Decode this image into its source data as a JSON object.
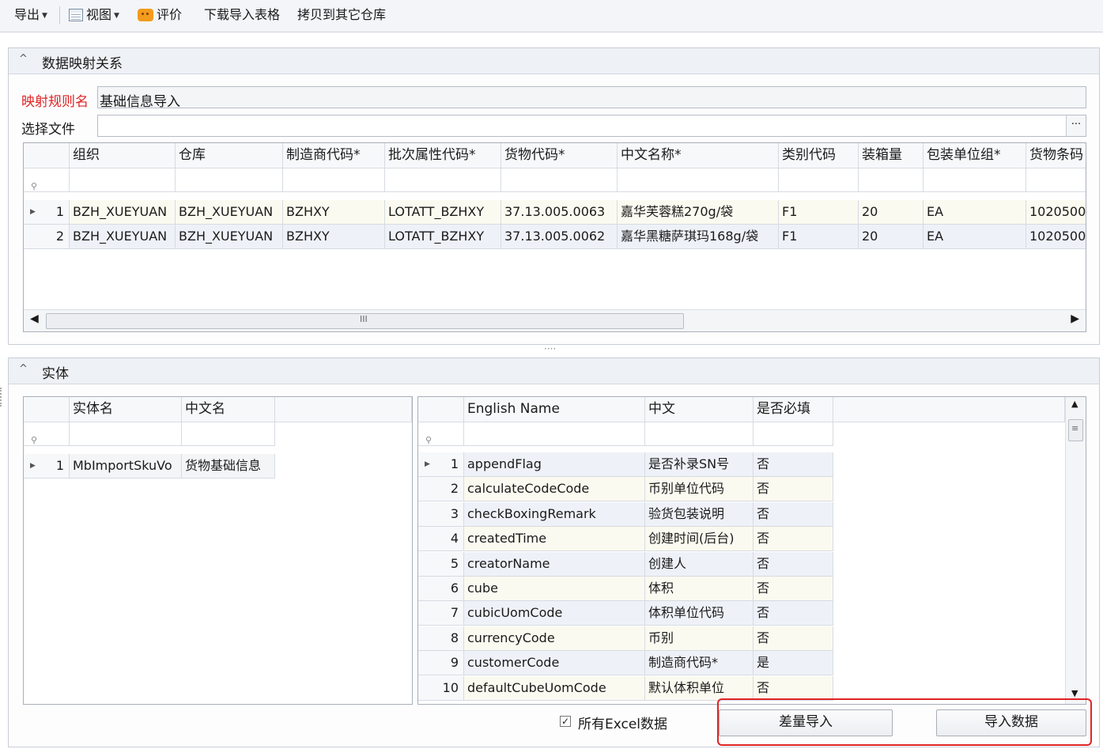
{
  "toolbar": {
    "export_label": "导出",
    "view_label": "视图",
    "evaluate_label": "评价",
    "download_template_label": "下载导入表格",
    "copy_to_warehouse_label": "拷贝到其它仓库"
  },
  "mapping_panel": {
    "title": "数据映射关系",
    "rule_name_label": "映射规则名",
    "rule_name_value": "基础信息导入",
    "file_label": "选择文件",
    "file_value": "",
    "browse_label": "···",
    "columns": [
      "组织",
      "仓库",
      "制造商代码*",
      "批次属性代码*",
      "货物代码*",
      "中文名称*",
      "类别代码",
      "装箱量",
      "包装单位组*",
      "货物条码"
    ],
    "rows": [
      {
        "no": "1",
        "cells": [
          "BZH_XUEYUAN",
          "BZH_XUEYUAN",
          "BZHXY",
          "LOTATT_BZHXY",
          "37.13.005.0063",
          "嘉华芙蓉糕270g/袋",
          "F1",
          "20",
          "EA",
          "1020500"
        ]
      },
      {
        "no": "2",
        "cells": [
          "BZH_XUEYUAN",
          "BZH_XUEYUAN",
          "BZHXY",
          "LOTATT_BZHXY",
          "37.13.005.0062",
          "嘉华黑糖萨琪玛168g/袋",
          "F1",
          "20",
          "EA",
          "1020500"
        ]
      }
    ],
    "scroll_grip": "III"
  },
  "splitter_label": "····",
  "entity_panel": {
    "title": "实体",
    "entity_columns": [
      "实体名",
      "中文名"
    ],
    "entity_rows": [
      {
        "no": "1",
        "name": "MbImportSkuVo",
        "cn": "货物基础信息"
      }
    ],
    "field_columns": [
      "English Name",
      "中文",
      "是否必填"
    ],
    "field_rows": [
      {
        "no": "1",
        "en": "appendFlag",
        "cn": "是否补录SN号",
        "req": "否"
      },
      {
        "no": "2",
        "en": "calculateCodeCode",
        "cn": "币别单位代码",
        "req": "否"
      },
      {
        "no": "3",
        "en": "checkBoxingRemark",
        "cn": "验货包装说明",
        "req": "否"
      },
      {
        "no": "4",
        "en": "createdTime",
        "cn": "创建时间(后台)",
        "req": "否"
      },
      {
        "no": "5",
        "en": "creatorName",
        "cn": "创建人",
        "req": "否"
      },
      {
        "no": "6",
        "en": "cube",
        "cn": "体积",
        "req": "否"
      },
      {
        "no": "7",
        "en": "cubicUomCode",
        "cn": "体积单位代码",
        "req": "否"
      },
      {
        "no": "8",
        "en": "currencyCode",
        "cn": "币别",
        "req": "否"
      },
      {
        "no": "9",
        "en": "customerCode",
        "cn": "制造商代码*",
        "req": "是"
      },
      {
        "no": "10",
        "en": "defaultCubeUomCode",
        "cn": "默认体积单位",
        "req": "否"
      }
    ],
    "all_excel_label": "所有Excel数据",
    "all_excel_checked": true,
    "diff_import_label": "差量导入",
    "import_label": "导入数据"
  },
  "colors": {
    "required_label": "#e02424",
    "highlight_box": "#e02424",
    "row_even": "#fbfaf0",
    "row_odd": "#eef2f8"
  },
  "icons": [
    "view-icon",
    "evaluate-icon",
    "filter-pin-icon",
    "row-indicator-icon",
    "collapse-icon"
  ]
}
